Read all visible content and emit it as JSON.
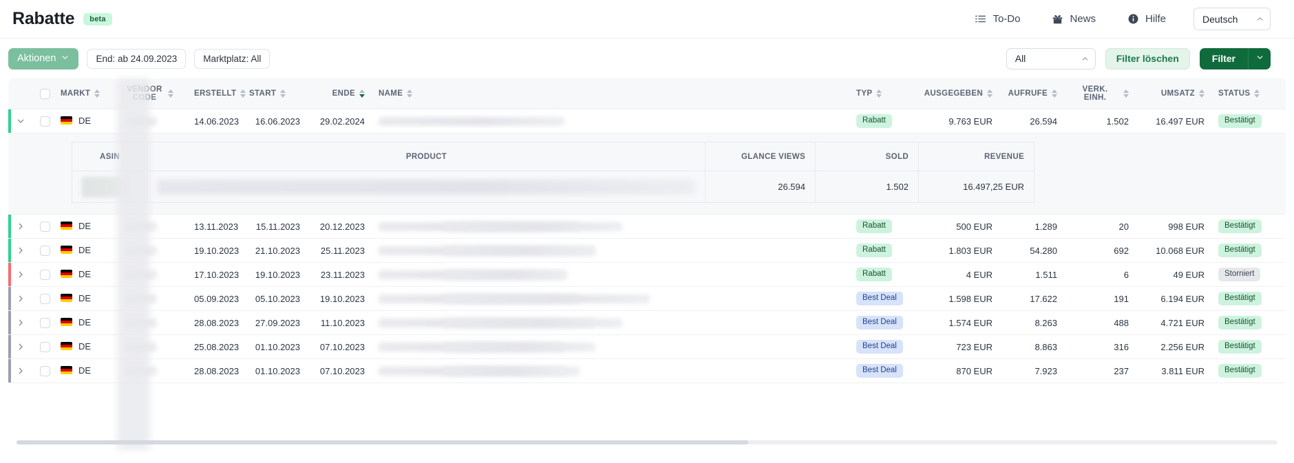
{
  "header": {
    "title": "Rabatte",
    "beta_label": "beta",
    "links": [
      {
        "label": "To-Do",
        "icon": "todo-list-icon"
      },
      {
        "label": "News",
        "icon": "gift-icon"
      },
      {
        "label": "Hilfe",
        "icon": "info-circle-icon"
      }
    ],
    "language": {
      "value": "Deutsch",
      "icon": "chevron-up-icon"
    }
  },
  "toolbar": {
    "actions_label": "Aktionen",
    "chips": [
      {
        "label": "End: ab 24.09.2023"
      },
      {
        "label": "Marktplatz: All"
      }
    ],
    "all_select": {
      "value": "All"
    },
    "clear_filters_label": "Filter löschen",
    "filter_label": "Filter"
  },
  "table": {
    "columns": [
      {
        "key": "markt",
        "label": "MARKT",
        "align": "left",
        "sorted": false
      },
      {
        "key": "vendorcode",
        "label": "VENDOR CODE",
        "align": "left",
        "sorted": false
      },
      {
        "key": "erstellt",
        "label": "ERSTELLT",
        "align": "right",
        "sorted": false
      },
      {
        "key": "start",
        "label": "START",
        "align": "right",
        "sorted": false
      },
      {
        "key": "ende",
        "label": "ENDE",
        "align": "right",
        "sorted": "desc"
      },
      {
        "key": "name",
        "label": "NAME",
        "align": "left",
        "sorted": false
      },
      {
        "key": "typ",
        "label": "TYP",
        "align": "left",
        "sorted": false
      },
      {
        "key": "ausgegeben",
        "label": "AUSGEGEBEN",
        "align": "right",
        "sorted": false
      },
      {
        "key": "aufrufe",
        "label": "AUFRUFE",
        "align": "right",
        "sorted": false
      },
      {
        "key": "verkeinh",
        "label": "VERK. EINH.",
        "align": "right",
        "sorted": false
      },
      {
        "key": "umsatz",
        "label": "UMSATZ",
        "align": "right",
        "sorted": false
      },
      {
        "key": "status",
        "label": "STATUS",
        "align": "left",
        "sorted": false
      }
    ],
    "rows": [
      {
        "indicator": "#2dd18c",
        "expanded": true,
        "markt": "DE",
        "vendorcode": "",
        "erstellt": "14.06.2023",
        "start": "16.06.2023",
        "ende": "29.02.2024",
        "name": "",
        "typ": "Rabatt",
        "typ_style": "rabatt",
        "ausgegeben": "9.763 EUR",
        "aufrufe": "26.594",
        "verkeinh": "1.502",
        "umsatz": "16.497 EUR",
        "status": "Bestätigt",
        "status_style": "best"
      },
      {
        "indicator": "#2dd18c",
        "expanded": false,
        "markt": "DE",
        "vendorcode": "",
        "erstellt": "13.11.2023",
        "start": "15.11.2023",
        "ende": "20.12.2023",
        "name": "",
        "typ": "Rabatt",
        "typ_style": "rabatt",
        "ausgegeben": "500 EUR",
        "aufrufe": "1.289",
        "verkeinh": "20",
        "umsatz": "998 EUR",
        "status": "Bestätigt",
        "status_style": "best"
      },
      {
        "indicator": "#2dd18c",
        "expanded": false,
        "markt": "DE",
        "vendorcode": "",
        "erstellt": "19.10.2023",
        "start": "21.10.2023",
        "ende": "25.11.2023",
        "name": "",
        "typ": "Rabatt",
        "typ_style": "rabatt",
        "ausgegeben": "1.803 EUR",
        "aufrufe": "54.280",
        "verkeinh": "692",
        "umsatz": "10.068 EUR",
        "status": "Bestätigt",
        "status_style": "best"
      },
      {
        "indicator": "#fa6a6a",
        "expanded": false,
        "markt": "DE",
        "vendorcode": "",
        "erstellt": "17.10.2023",
        "start": "19.10.2023",
        "ende": "23.11.2023",
        "name": "",
        "typ": "Rabatt",
        "typ_style": "rabatt",
        "ausgegeben": "4 EUR",
        "aufrufe": "1.511",
        "verkeinh": "6",
        "umsatz": "49 EUR",
        "status": "Storniert",
        "status_style": "storn"
      },
      {
        "indicator": "#9aa0ae",
        "expanded": false,
        "markt": "DE",
        "vendorcode": "",
        "erstellt": "05.09.2023",
        "start": "05.10.2023",
        "ende": "19.10.2023",
        "name": "",
        "typ": "Best Deal",
        "typ_style": "bestdeal",
        "ausgegeben": "1.598 EUR",
        "aufrufe": "17.622",
        "verkeinh": "191",
        "umsatz": "6.194 EUR",
        "status": "Bestätigt",
        "status_style": "best"
      },
      {
        "indicator": "#9aa0ae",
        "expanded": false,
        "markt": "DE",
        "vendorcode": "",
        "erstellt": "28.08.2023",
        "start": "27.09.2023",
        "ende": "11.10.2023",
        "name": "",
        "typ": "Best Deal",
        "typ_style": "bestdeal",
        "ausgegeben": "1.574 EUR",
        "aufrufe": "8.263",
        "verkeinh": "488",
        "umsatz": "4.721 EUR",
        "status": "Bestätigt",
        "status_style": "best"
      },
      {
        "indicator": "#9aa0ae",
        "expanded": false,
        "markt": "DE",
        "vendorcode": "",
        "erstellt": "25.08.2023",
        "start": "01.10.2023",
        "ende": "07.10.2023",
        "name": "",
        "typ": "Best Deal",
        "typ_style": "bestdeal",
        "ausgegeben": "723 EUR",
        "aufrufe": "8.863",
        "verkeinh": "316",
        "umsatz": "2.256 EUR",
        "status": "Bestätigt",
        "status_style": "best"
      },
      {
        "indicator": "#9aa0ae",
        "expanded": false,
        "markt": "DE",
        "vendorcode": "",
        "erstellt": "28.08.2023",
        "start": "01.10.2023",
        "ende": "07.10.2023",
        "name": "",
        "typ": "Best Deal",
        "typ_style": "bestdeal",
        "ausgegeben": "870 EUR",
        "aufrufe": "7.923",
        "verkeinh": "237",
        "umsatz": "3.811 EUR",
        "status": "Bestätigt",
        "status_style": "best"
      }
    ]
  },
  "subtable": {
    "columns": [
      {
        "key": "asin",
        "label": "ASIN",
        "align": "left"
      },
      {
        "key": "product",
        "label": "PRODUCT",
        "align": "left"
      },
      {
        "key": "glanceviews",
        "label": "GLANCE VIEWS",
        "align": "right"
      },
      {
        "key": "sold",
        "label": "SOLD",
        "align": "right"
      },
      {
        "key": "revenue",
        "label": "REVENUE",
        "align": "right"
      }
    ],
    "rows": [
      {
        "asin": "",
        "product": "",
        "glanceviews": "26.594",
        "sold": "1.502",
        "revenue": "16.497,25 EUR"
      }
    ]
  },
  "colors": {
    "accent_green": "#106b3c",
    "status_active": "#2dd18c",
    "status_cancelled": "#fa6a6a",
    "status_expired": "#9aa0ae"
  }
}
